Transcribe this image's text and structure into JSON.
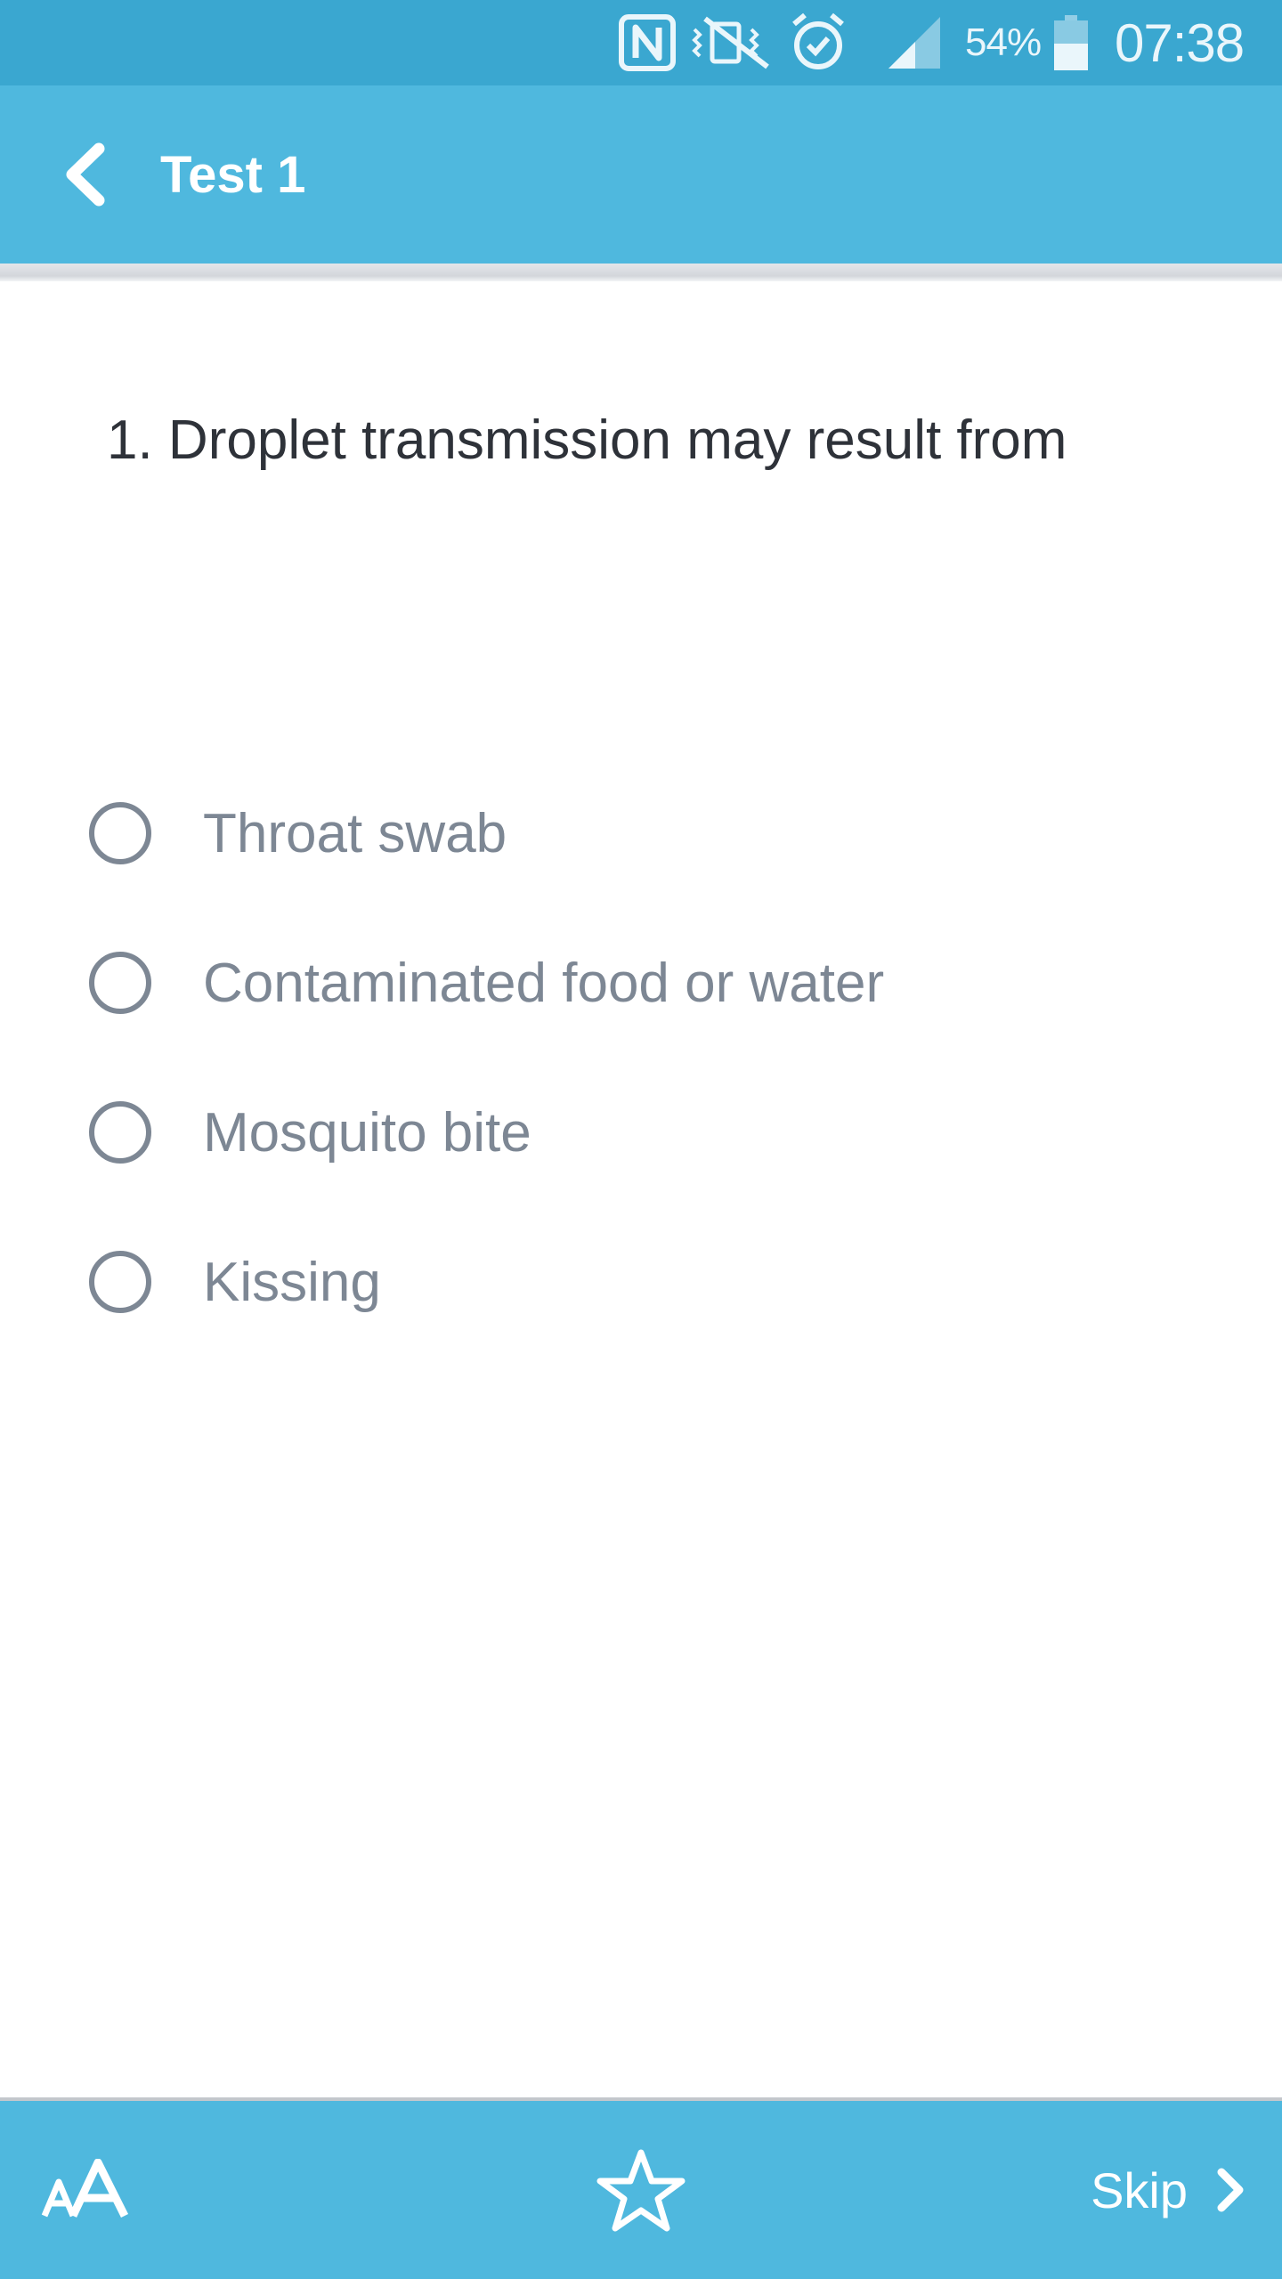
{
  "status_bar": {
    "battery_percent_text": "54%",
    "battery_level": 0.54,
    "time": "07:38",
    "icons": [
      "nfc-icon",
      "vibrate-icon",
      "alarm-icon",
      "signal-icon",
      "battery-icon"
    ]
  },
  "app_bar": {
    "title": "Test 1",
    "back_icon": "chevron-left-icon"
  },
  "question": {
    "text": "1. Droplet transmission may result from",
    "options": [
      {
        "label": "Throat swab",
        "selected": false
      },
      {
        "label": "Contaminated food or water",
        "selected": false
      },
      {
        "label": "Mosquito bite",
        "selected": false
      },
      {
        "label": "Kissing",
        "selected": false
      }
    ]
  },
  "bottom_bar": {
    "font_size_icon": "font-size-icon",
    "bookmark_icon": "star-icon",
    "skip_label": "Skip",
    "skip_icon": "chevron-right-icon"
  },
  "colors": {
    "status_bar": "#3aa7d0",
    "app_bar": "#4fb8de",
    "question_text": "#2e3239",
    "option_text": "#7d8794"
  }
}
